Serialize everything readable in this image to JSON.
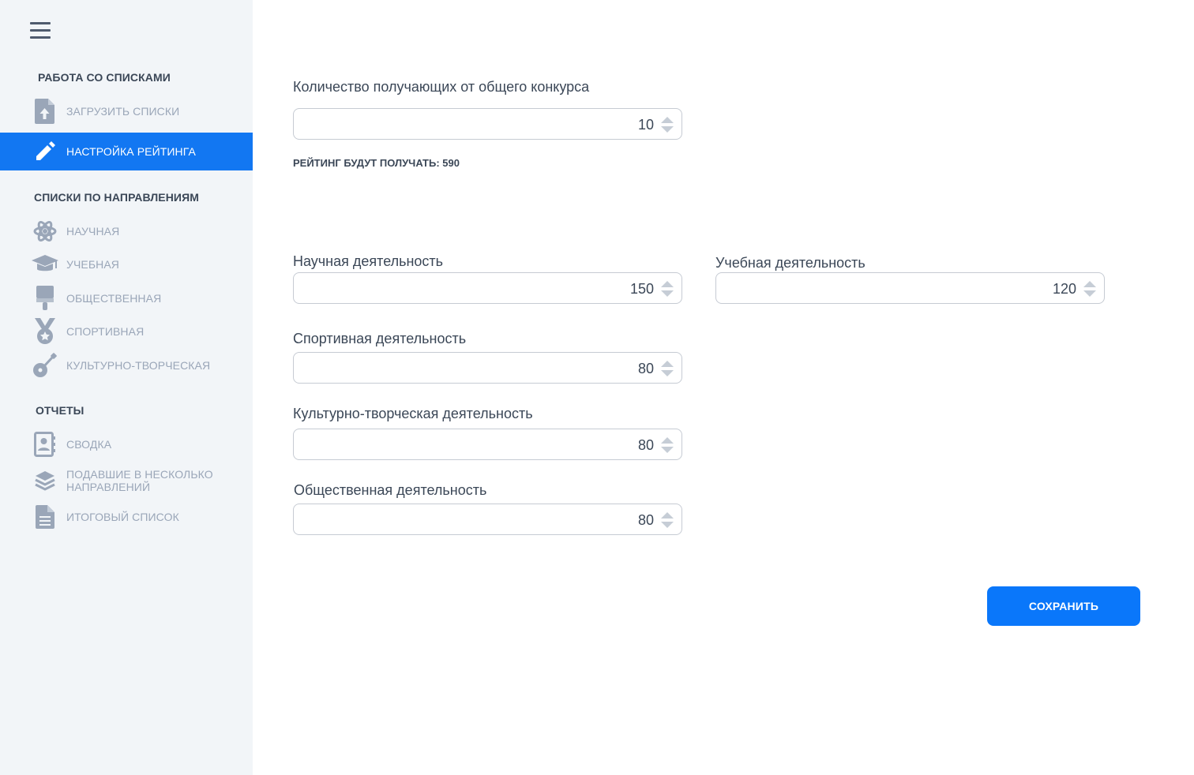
{
  "sidebar": {
    "section_lists": "РАБОТА СО СПИСКАМИ",
    "upload_lists": "ЗАГРУЗИТЬ СПИСКИ",
    "rating_settings": "НАСТРОЙКА РЕЙТИНГА",
    "section_directions": "СПИСКИ ПО НАПРАВЛЕНИЯМ",
    "directions": [
      "НАУЧНАЯ",
      "УЧЕБНАЯ",
      "ОБЩЕСТВЕННАЯ",
      "СПОРТИВНАЯ",
      "КУЛЬТУРНО-ТВОРЧЕСКАЯ"
    ],
    "section_reports": "ОТЧЕТЫ",
    "reports": [
      "СВОДКА",
      "ПОДАВШИЕ В НЕСКОЛЬКО НАПРАВЛЕНИЙ",
      "ИТОГОВЫЙ СПИСОК"
    ]
  },
  "colors": {
    "active_background": "#1277f2",
    "sidebar_background": "#f2f5f8",
    "primary_button": "#0a77fa",
    "icon_gray": "#9aa6b8"
  },
  "main": {
    "general": {
      "label": "Количество получающих от общего конкурса",
      "value": "10"
    },
    "summary": "РЕЙТИНГ БУДУТ ПОЛУЧАТЬ: 590",
    "science": {
      "label": "Научная деятельность",
      "value": "150"
    },
    "study": {
      "label": "Учебная деятельность",
      "value": "120"
    },
    "sport": {
      "label": "Спортивная деятельность",
      "value": "80"
    },
    "culture": {
      "label": "Культурно-творческая деятельность",
      "value": "80"
    },
    "social": {
      "label": "Общественная деятельность",
      "value": "80"
    },
    "save_label": "СОХРАНИТЬ"
  }
}
